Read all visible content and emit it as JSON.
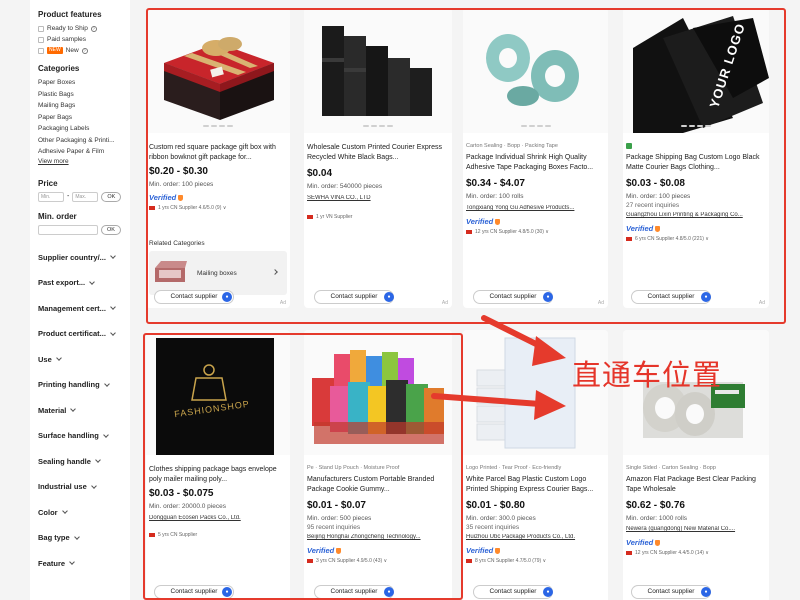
{
  "sidebar": {
    "product_features": {
      "heading": "Product features",
      "items": [
        {
          "label": "Ready to Ship",
          "info": "?"
        },
        {
          "label": "Paid samples"
        },
        {
          "badge": "NEW",
          "label": "New",
          "info": "?"
        }
      ]
    },
    "categories": {
      "heading": "Categories",
      "items": [
        "Paper Boxes",
        "Plastic Bags",
        "Mailing Bags",
        "Paper Bags",
        "Packaging Labels",
        "Other Packaging & Printi...",
        "Adhesive Paper & Film"
      ],
      "view_more": "View more"
    },
    "price": {
      "heading": "Price",
      "min_placeholder": "Min.",
      "dash": "-",
      "max_placeholder": "Max.",
      "ok": "OK"
    },
    "min_order": {
      "heading": "Min. order",
      "ok": "OK"
    },
    "filters": [
      "Supplier country/...",
      "Past export...",
      "Management cert...",
      "Product certificat...",
      "Use",
      "Printing handling",
      "Material",
      "Surface handling",
      "Sealing handle",
      "Industrial use",
      "Color",
      "Bag type",
      "Feature"
    ]
  },
  "cards": [
    {
      "tagline": "",
      "title": "Custom red square package gift box with ribbon bowknot gift package for...",
      "price": "$0.20 - $0.30",
      "minorder": "Min. order: 100 pieces",
      "inquiries": "",
      "supplier": "",
      "verified": "Verified",
      "meta": "1 yrs  CN Supplier  4.6/5.0 (9) ∨",
      "contact": "Contact supplier",
      "related_title": "Related Categories",
      "related_label": "Mailing boxes",
      "ad": "Ad"
    },
    {
      "tagline": "",
      "title": "Wholesale Custom Printed Courier Express Recycled White Black Bags...",
      "price": "$0.04",
      "minorder": "Min. order: 540000 pieces",
      "inquiries": "",
      "supplier": "SEWHA VINA CO., LTD",
      "verified": "",
      "meta": "1 yr  VN Supplier",
      "contact": "Contact supplier",
      "ad": "Ad"
    },
    {
      "tagline": "Carton Sealing · Bopp · Packing Tape",
      "title": "Package Individual Shrink High Quality Adhesive Tape Packaging Boxes Facto...",
      "price": "$0.34 - $4.07",
      "minorder": "Min. order: 100 rolls",
      "inquiries": "",
      "supplier": "Tongxiang Yong Gu Adhesive Products...",
      "verified": "Verified",
      "meta": "12 yrs  CN Supplier  4.8/5.0 (30) ∨",
      "contact": "Contact supplier",
      "ad": "Ad"
    },
    {
      "tagline": "",
      "title": "Package Shipping Bag Custom Logo Black Matte Courier Bags Clothing...",
      "price": "$0.03 - $0.08",
      "minorder": "Min. order: 100 pieces",
      "inquiries": "27 recent inquiries",
      "supplier": "Guangzhou Lixin Printing & Packaging Co...",
      "verified": "Verified",
      "meta": "6 yrs  CN Supplier  4.8/5.0 (221) ∨",
      "contact": "Contact supplier",
      "img_text": "YOUR LOGO",
      "ad": "Ad"
    },
    {
      "tagline": "",
      "title": "Clothes shipping package bags envelope poly mailer mailing poly...",
      "price": "$0.03 - $0.075",
      "minorder": "Min. order: 20000.0 pieces",
      "inquiries": "",
      "supplier": "Dongguan Ecosen Packs Co., Ltd.",
      "verified": "",
      "meta": "5 yrs  CN Supplier",
      "contact": "Contact supplier",
      "img_text": "FASHIONSHOP"
    },
    {
      "tagline": "Pe · Stand Up Pouch · Moisture Proof",
      "title": "Manufacturers Custom Portable Branded Package Cookie Gummy...",
      "price": "$0.01 - $0.07",
      "minorder": "Min. order: 500 pieces",
      "inquiries": "95 recent inquiries",
      "supplier": "Beijing Honghai Zhongcheng Technology...",
      "verified": "Verified",
      "meta": "3 yrs  CN Supplier  4.9/5.0 (43) ∨",
      "contact": "Contact supplier"
    },
    {
      "tagline": "Logo Printed · Tear Proof · Eco-friendly",
      "title": "White Parcel Bag Plastic Custom Logo Printed Shipping Express Courier Bags...",
      "price": "$0.01 - $0.80",
      "minorder": "Min. order: 300.0 pieces",
      "inquiries": "35 recent inquiries",
      "supplier": "Huizhou Ubc Package Products Co., Ltd.",
      "verified": "Verified",
      "meta": "8 yrs  CN Supplier  4.7/5.0 (79) ∨",
      "contact": "Contact supplier"
    },
    {
      "tagline": "Single Sided · Carton Sealing · Bopp",
      "title": "Amazon Flat Package Best Clear Packing Tape Wholesale",
      "price": "$0.62 - $0.76",
      "minorder": "Min. order: 1000 rolls",
      "inquiries": "",
      "supplier": "Newera (guangdong) New Material Co....",
      "verified": "Verified",
      "meta": "12 yrs  CN Supplier  4.4/5.0 (14) ∨",
      "contact": "Contact supplier"
    }
  ],
  "annotation": {
    "text": "直通车位置",
    "color": "#e5352a"
  },
  "colors": {
    "accent": "#ff6a00",
    "verified": "#2d63d6",
    "annotation_red": "#e53a2c"
  }
}
